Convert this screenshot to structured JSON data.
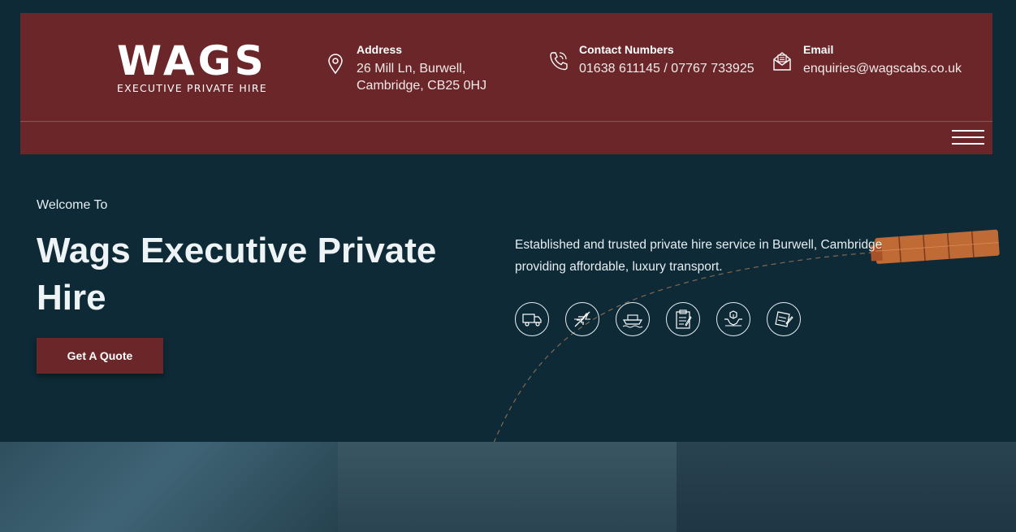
{
  "header": {
    "logo": {
      "word": "WAGS",
      "subtitle": "EXECUTIVE PRIVATE HIRE"
    },
    "address": {
      "title": "Address",
      "line1": "26 Mill Ln, Burwell,",
      "line2": "Cambridge, CB25 0HJ",
      "icon": "map-pin-icon"
    },
    "phone": {
      "title": "Contact Numbers",
      "value": "01638 611145 / 07767 733925",
      "icon": "phone-icon"
    },
    "email": {
      "title": "Email",
      "value": "enquiries@wagscabs.co.uk",
      "icon": "envelope-icon"
    },
    "menu_icon": "hamburger-menu-icon"
  },
  "hero": {
    "welcome": "Welcome To",
    "title": "Wags Executive Private Hire",
    "cta_label": "Get A Quote",
    "tagline": "Established and trusted private hire service in Burwell, Cambridge providing affordable, luxury transport.",
    "service_icons": [
      "truck-icon",
      "airplane-icon",
      "ship-icon",
      "clipboard-icon",
      "hands-box-icon",
      "document-icon"
    ]
  },
  "colors": {
    "background": "#0d2a36",
    "header": "#6a2628",
    "accent": "#c06a36",
    "text": "#eef3f5"
  }
}
